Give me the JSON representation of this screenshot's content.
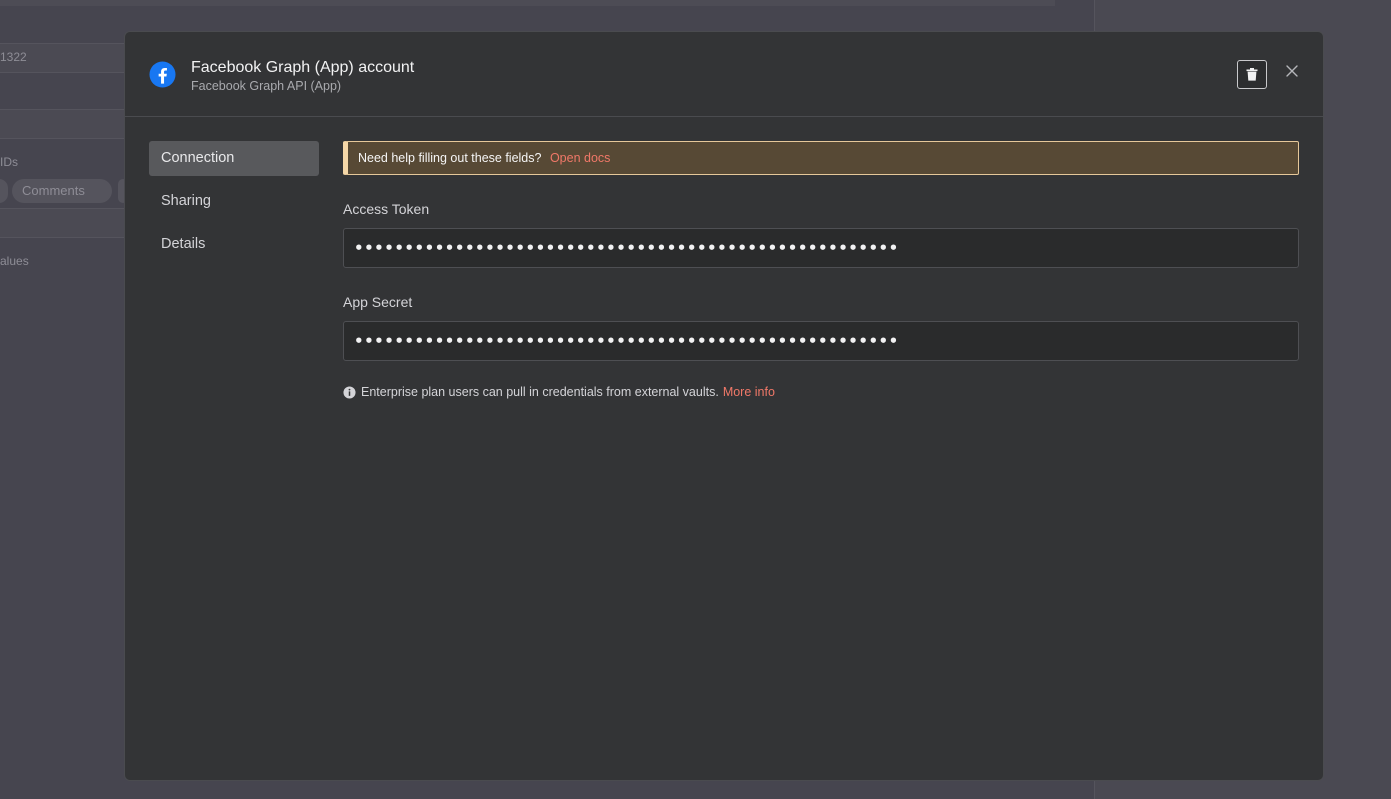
{
  "background": {
    "row_value": "1322",
    "section_ids": "IDs",
    "pill_label": "Comments",
    "section_values": "alues"
  },
  "modal": {
    "title": "Facebook Graph (App) account",
    "subtitle": "Facebook Graph API (App)",
    "icon": "facebook-icon",
    "delete_icon": "trash-icon",
    "close_icon": "close-icon"
  },
  "sidebar": {
    "items": [
      {
        "label": "Connection",
        "active": true
      },
      {
        "label": "Sharing",
        "active": false
      },
      {
        "label": "Details",
        "active": false
      }
    ]
  },
  "notice": {
    "text": "Need help filling out these fields?",
    "link": "Open docs"
  },
  "fields": {
    "access_token": {
      "label": "Access Token",
      "value": "••••••••••••••••••••••••••••••••••••••••••••••••••••••"
    },
    "app_secret": {
      "label": "App Secret",
      "value": "••••••••••••••••••••••••••••••••••••••••••••••••••••••"
    }
  },
  "info": {
    "text": "Enterprise plan users can pull in credentials from external vaults.",
    "link": "More info"
  },
  "colors": {
    "accent": "#f07868",
    "notice_bg": "#574935",
    "facebook_blue": "#1877f2"
  }
}
